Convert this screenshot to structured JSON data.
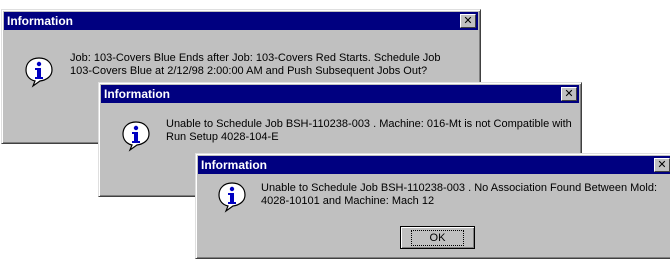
{
  "dialogs": [
    {
      "title": "Information",
      "close_label": "✕",
      "icon": "info-icon",
      "message_lines": [
        "Job: 103-Covers Blue Ends after Job: 103-Covers Red Starts.  Schedule Job",
        "103-Covers Blue at 2/12/98 2:00:00 AM and Push Subsequent Jobs Out?"
      ]
    },
    {
      "title": "Information",
      "close_label": "✕",
      "icon": "info-icon",
      "message_lines": [
        "Unable to Schedule Job  BSH-110238-003 .  Machine: 016-Mt is not Compatible with",
        "Run Setup 4028-104-E"
      ]
    },
    {
      "title": "Information",
      "close_label": "✕",
      "icon": "info-icon",
      "message_lines": [
        "Unable to Schedule Job  BSH-110238-003 .  No Association Found Between Mold:",
        "4028-10101 and Machine: Mach 12"
      ],
      "ok_label": "OK"
    }
  ]
}
